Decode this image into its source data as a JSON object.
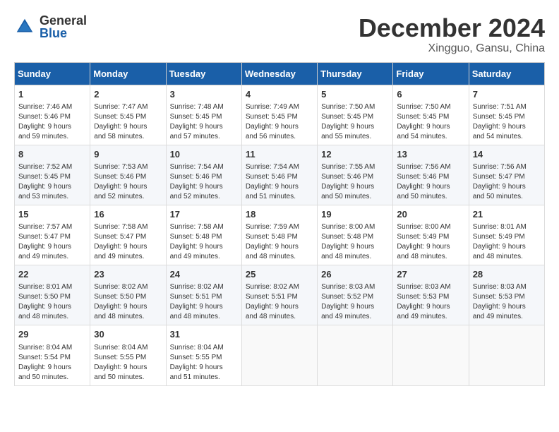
{
  "header": {
    "logo_general": "General",
    "logo_blue": "Blue",
    "title": "December 2024",
    "location": "Xingguo, Gansu, China"
  },
  "days_of_week": [
    "Sunday",
    "Monday",
    "Tuesday",
    "Wednesday",
    "Thursday",
    "Friday",
    "Saturday"
  ],
  "weeks": [
    [
      {
        "day": "1",
        "info": "Sunrise: 7:46 AM\nSunset: 5:46 PM\nDaylight: 9 hours\nand 59 minutes."
      },
      {
        "day": "2",
        "info": "Sunrise: 7:47 AM\nSunset: 5:45 PM\nDaylight: 9 hours\nand 58 minutes."
      },
      {
        "day": "3",
        "info": "Sunrise: 7:48 AM\nSunset: 5:45 PM\nDaylight: 9 hours\nand 57 minutes."
      },
      {
        "day": "4",
        "info": "Sunrise: 7:49 AM\nSunset: 5:45 PM\nDaylight: 9 hours\nand 56 minutes."
      },
      {
        "day": "5",
        "info": "Sunrise: 7:50 AM\nSunset: 5:45 PM\nDaylight: 9 hours\nand 55 minutes."
      },
      {
        "day": "6",
        "info": "Sunrise: 7:50 AM\nSunset: 5:45 PM\nDaylight: 9 hours\nand 54 minutes."
      },
      {
        "day": "7",
        "info": "Sunrise: 7:51 AM\nSunset: 5:45 PM\nDaylight: 9 hours\nand 54 minutes."
      }
    ],
    [
      {
        "day": "8",
        "info": "Sunrise: 7:52 AM\nSunset: 5:45 PM\nDaylight: 9 hours\nand 53 minutes."
      },
      {
        "day": "9",
        "info": "Sunrise: 7:53 AM\nSunset: 5:46 PM\nDaylight: 9 hours\nand 52 minutes."
      },
      {
        "day": "10",
        "info": "Sunrise: 7:54 AM\nSunset: 5:46 PM\nDaylight: 9 hours\nand 52 minutes."
      },
      {
        "day": "11",
        "info": "Sunrise: 7:54 AM\nSunset: 5:46 PM\nDaylight: 9 hours\nand 51 minutes."
      },
      {
        "day": "12",
        "info": "Sunrise: 7:55 AM\nSunset: 5:46 PM\nDaylight: 9 hours\nand 50 minutes."
      },
      {
        "day": "13",
        "info": "Sunrise: 7:56 AM\nSunset: 5:46 PM\nDaylight: 9 hours\nand 50 minutes."
      },
      {
        "day": "14",
        "info": "Sunrise: 7:56 AM\nSunset: 5:47 PM\nDaylight: 9 hours\nand 50 minutes."
      }
    ],
    [
      {
        "day": "15",
        "info": "Sunrise: 7:57 AM\nSunset: 5:47 PM\nDaylight: 9 hours\nand 49 minutes."
      },
      {
        "day": "16",
        "info": "Sunrise: 7:58 AM\nSunset: 5:47 PM\nDaylight: 9 hours\nand 49 minutes."
      },
      {
        "day": "17",
        "info": "Sunrise: 7:58 AM\nSunset: 5:48 PM\nDaylight: 9 hours\nand 49 minutes."
      },
      {
        "day": "18",
        "info": "Sunrise: 7:59 AM\nSunset: 5:48 PM\nDaylight: 9 hours\nand 48 minutes."
      },
      {
        "day": "19",
        "info": "Sunrise: 8:00 AM\nSunset: 5:48 PM\nDaylight: 9 hours\nand 48 minutes."
      },
      {
        "day": "20",
        "info": "Sunrise: 8:00 AM\nSunset: 5:49 PM\nDaylight: 9 hours\nand 48 minutes."
      },
      {
        "day": "21",
        "info": "Sunrise: 8:01 AM\nSunset: 5:49 PM\nDaylight: 9 hours\nand 48 minutes."
      }
    ],
    [
      {
        "day": "22",
        "info": "Sunrise: 8:01 AM\nSunset: 5:50 PM\nDaylight: 9 hours\nand 48 minutes."
      },
      {
        "day": "23",
        "info": "Sunrise: 8:02 AM\nSunset: 5:50 PM\nDaylight: 9 hours\nand 48 minutes."
      },
      {
        "day": "24",
        "info": "Sunrise: 8:02 AM\nSunset: 5:51 PM\nDaylight: 9 hours\nand 48 minutes."
      },
      {
        "day": "25",
        "info": "Sunrise: 8:02 AM\nSunset: 5:51 PM\nDaylight: 9 hours\nand 48 minutes."
      },
      {
        "day": "26",
        "info": "Sunrise: 8:03 AM\nSunset: 5:52 PM\nDaylight: 9 hours\nand 49 minutes."
      },
      {
        "day": "27",
        "info": "Sunrise: 8:03 AM\nSunset: 5:53 PM\nDaylight: 9 hours\nand 49 minutes."
      },
      {
        "day": "28",
        "info": "Sunrise: 8:03 AM\nSunset: 5:53 PM\nDaylight: 9 hours\nand 49 minutes."
      }
    ],
    [
      {
        "day": "29",
        "info": "Sunrise: 8:04 AM\nSunset: 5:54 PM\nDaylight: 9 hours\nand 50 minutes."
      },
      {
        "day": "30",
        "info": "Sunrise: 8:04 AM\nSunset: 5:55 PM\nDaylight: 9 hours\nand 50 minutes."
      },
      {
        "day": "31",
        "info": "Sunrise: 8:04 AM\nSunset: 5:55 PM\nDaylight: 9 hours\nand 51 minutes."
      },
      null,
      null,
      null,
      null
    ]
  ]
}
